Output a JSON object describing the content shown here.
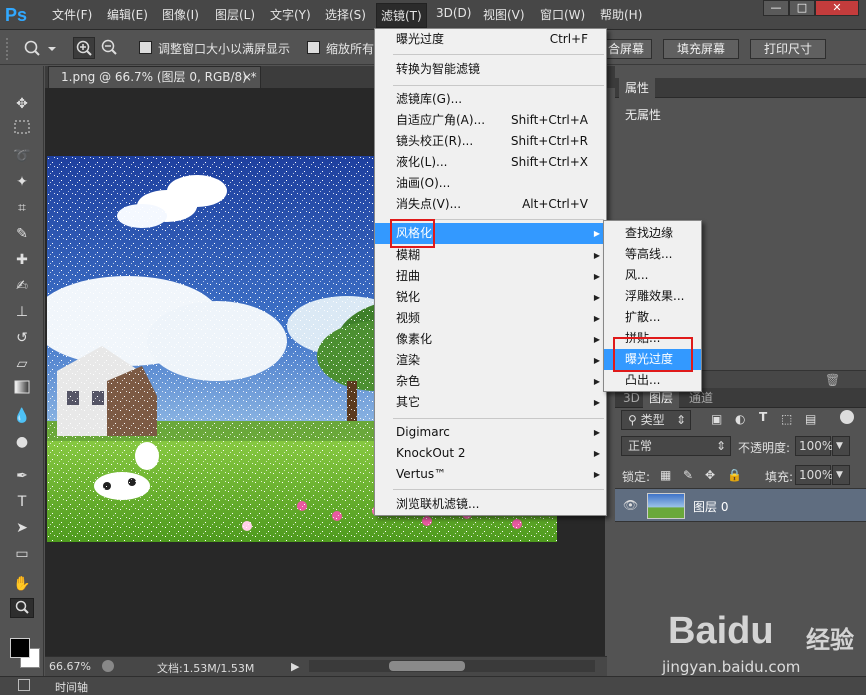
{
  "app": {
    "logo": "Ps"
  },
  "menubar": {
    "items": [
      "文件(F)",
      "编辑(E)",
      "图像(I)",
      "图层(L)",
      "文字(Y)",
      "选择(S)",
      "滤镜(T)",
      "3D(D)",
      "视图(V)",
      "窗口(W)",
      "帮助(H)"
    ],
    "window_buttons": [
      "—",
      "□",
      "✕"
    ]
  },
  "options_bar": {
    "resize_windows_label": "调整窗口大小以满屏显示",
    "zoom_all_label": "缩放所有",
    "fit_screen_button": "合屏幕",
    "fill_screen_button": "填充屏幕",
    "print_size_button": "打印尺寸"
  },
  "document": {
    "tab_title": "1.png @ 66.7% (图层 0, RGB/8) *",
    "close_glyph": "×",
    "zoom": "66.67%",
    "doc_info": "文档:1.53M/1.53M",
    "timeline_label": "时间轴"
  },
  "filter_menu": {
    "last_filter": {
      "label": "曝光过度",
      "shortcut": "Ctrl+F"
    },
    "convert_smart": "转换为智能滤镜",
    "group1": [
      {
        "label": "滤镜库(G)...",
        "shortcut": ""
      },
      {
        "label": "自适应广角(A)...",
        "shortcut": "Shift+Ctrl+A"
      },
      {
        "label": "镜头校正(R)...",
        "shortcut": "Shift+Ctrl+R"
      },
      {
        "label": "液化(L)...",
        "shortcut": "Shift+Ctrl+X"
      },
      {
        "label": "油画(O)...",
        "shortcut": ""
      },
      {
        "label": "消失点(V)...",
        "shortcut": "Alt+Ctrl+V"
      }
    ],
    "submenus": [
      "风格化",
      "模糊",
      "扭曲",
      "锐化",
      "视频",
      "像素化",
      "渲染",
      "杂色",
      "其它"
    ],
    "plugins": [
      "Digimarc",
      "KnockOut 2",
      "Vertus™"
    ],
    "browse_online": "浏览联机滤镜..."
  },
  "stylize_submenu": {
    "items": [
      "查找边缘",
      "等高线...",
      "风...",
      "浮雕效果...",
      "扩散...",
      "拼贴...",
      "曝光过度",
      "凸出..."
    ],
    "highlighted": "曝光过度"
  },
  "properties_panel": {
    "tab": "属性",
    "content": "无属性"
  },
  "layers_panel": {
    "tabs": [
      "3D",
      "图层",
      "通道"
    ],
    "filter_kind": "类型",
    "blend_mode": "正常",
    "opacity_label": "不透明度:",
    "opacity_value": "100%",
    "lock_label": "锁定:",
    "fill_label": "填充:",
    "fill_value": "100%",
    "layers": [
      {
        "name": "图层 0",
        "visible": true
      }
    ]
  },
  "watermark": {
    "brand": "Baidu",
    "brand_suffix": "经验",
    "url": "jingyan.baidu.com"
  },
  "colors": {
    "menu_highlight": "#3399ff",
    "annotation_red": "#e01a1a",
    "ui_dark": "#535353"
  }
}
